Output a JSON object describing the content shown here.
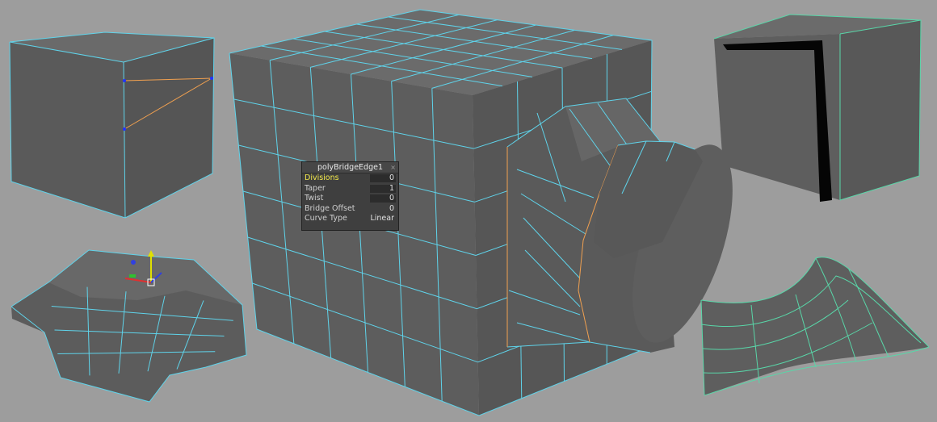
{
  "viewport": {
    "background": "#9d9d9d",
    "face_color": "#606060",
    "wire_color": "#5fd3ea",
    "selected_edge_color": "#f0a050",
    "surface_wire_color": "#59d6a8"
  },
  "in_view_editor": {
    "title": "polyBridgeEdge1",
    "close_icon": "×",
    "rows": [
      {
        "label": "Divisions",
        "value": "0",
        "active": true
      },
      {
        "label": "Taper",
        "value": "1"
      },
      {
        "label": "Twist",
        "value": "0"
      },
      {
        "label": "Bridge Offset",
        "value": "0"
      },
      {
        "label": "Curve Type",
        "value": "Linear"
      }
    ]
  },
  "objects": [
    {
      "name": "split-edge-cube",
      "icon": "cube-mesh"
    },
    {
      "name": "bridged-cylinder-cube",
      "icon": "subdivided-cube-mesh"
    },
    {
      "name": "cut-cube",
      "icon": "cube-mesh"
    },
    {
      "name": "extruded-mesh",
      "icon": "poly-mesh"
    },
    {
      "name": "curved-surface",
      "icon": "nurbs-surface"
    }
  ]
}
